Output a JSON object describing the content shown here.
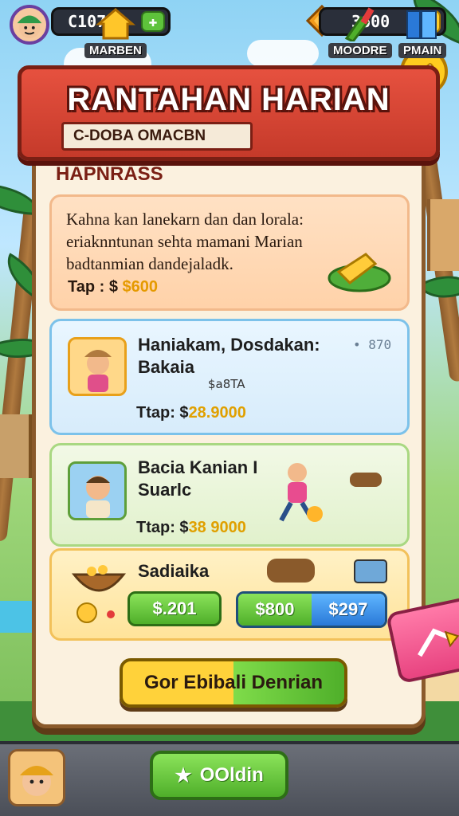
{
  "topbar": {
    "coins": "C1070",
    "gems": "3600"
  },
  "header": {
    "title": "RANTAHAN HARIAN",
    "subtitle": "C-DOBA OMACBN"
  },
  "section": {
    "heading": "HAPNRASS"
  },
  "intro_card": {
    "text": "Kahna kan lanekarn dan dan lorala: eriaknntunan sehta mamani Marian badtanmian dandejaladk.",
    "tag": "Tap : $",
    "price": "$600"
  },
  "blue_card": {
    "title": "Haniakam, Dosdakan: Bakaia",
    "badge": "870",
    "detail": "$a8TA",
    "tag": "Ttap: $",
    "price": "28.9000"
  },
  "green_card": {
    "title": "Bacia Kanian I Suarlc",
    "tag": "Ttap: $",
    "price": "38 9000"
  },
  "yellow_card": {
    "title": "Sadiaika",
    "btn_left": "$.201",
    "btn_split_left": "$800",
    "btn_split_right": "$297"
  },
  "cta": {
    "label": "Gor Ebibali Denrian"
  },
  "nav": {
    "items": [
      {
        "label": "MARBEN"
      },
      {
        "label": "OOldin"
      },
      {
        "label": "MOODRE"
      },
      {
        "label": "PMAIN"
      }
    ]
  },
  "colors": {
    "banner_red": "#d8473a",
    "panel_cream": "#fbf1df",
    "accent_green": "#5ec23b",
    "accent_yellow": "#ffcd2a",
    "accent_blue": "#2a79d8",
    "accent_pink": "#e84380"
  }
}
